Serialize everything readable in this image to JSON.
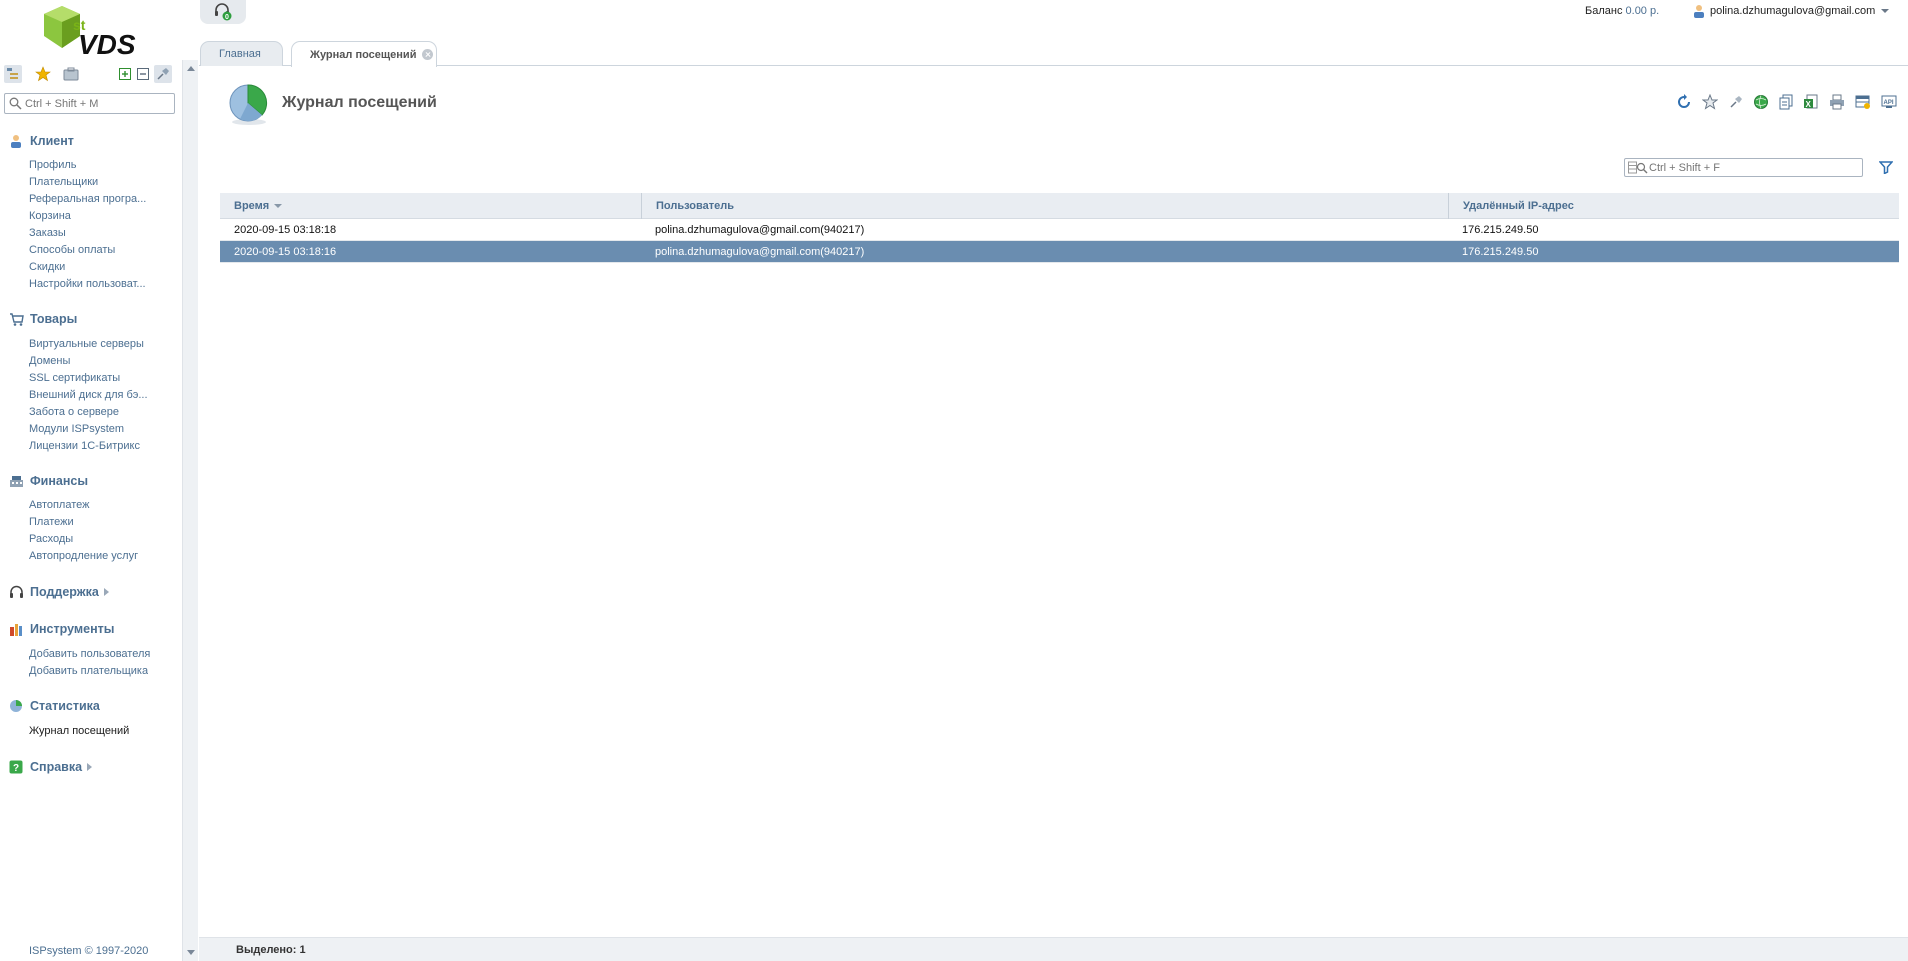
{
  "brand": {
    "logo_text": "VDS",
    "logo_sup": "st"
  },
  "header": {
    "notifications_count": "0",
    "balance_label": "Баланс",
    "balance_amount": "0.00 р.",
    "user_email": "polina.dzhumagulova@gmail.com"
  },
  "sidebar": {
    "search_placeholder": "Ctrl + Shift + M",
    "groups": [
      {
        "title": "Клиент",
        "icon": "client-icon",
        "items": [
          "Профиль",
          "Плательщики",
          "Реферальная програ...",
          "Корзина",
          "Заказы",
          "Способы оплаты",
          "Скидки",
          "Настройки пользоват..."
        ]
      },
      {
        "title": "Товары",
        "icon": "cart-icon",
        "items": [
          "Виртуальные серверы",
          "Домены",
          "SSL сертификаты",
          "Внешний диск для бэ...",
          "Забота о сервере",
          "Модули ISPsystem",
          "Лицензии 1С-Битрикс"
        ]
      },
      {
        "title": "Финансы",
        "icon": "finance-icon",
        "items": [
          "Автоплатеж",
          "Платежи",
          "Расходы",
          "Автопродление услуг"
        ]
      },
      {
        "title": "Поддержка",
        "icon": "headset-icon",
        "items": []
      },
      {
        "title": "Инструменты",
        "icon": "tools-icon",
        "items": [
          "Добавить пользователя",
          "Добавить плательщика"
        ]
      },
      {
        "title": "Статистика",
        "icon": "statistics-icon",
        "items": [
          "Журнал посещений"
        ]
      },
      {
        "title": "Справка",
        "icon": "help-icon",
        "items": []
      }
    ],
    "copyright": "ISPsystem © 1997-2020"
  },
  "tabs": [
    {
      "label": "Главная"
    },
    {
      "label": "Журнал посещений"
    }
  ],
  "page": {
    "title": "Журнал посещений",
    "filter_placeholder": "Ctrl + Shift + F"
  },
  "table": {
    "columns": [
      "Время",
      "Пользователь",
      "Удалённый IP-адрес"
    ],
    "rows": [
      [
        "2020-09-15 03:18:18",
        "polina.dzhumagulova@gmail.com(940217)",
        "176.215.249.50"
      ],
      [
        "2020-09-15 03:18:16",
        "polina.dzhumagulova@gmail.com(940217)",
        "176.215.249.50"
      ]
    ]
  },
  "status": {
    "selected_label": "Выделено: 1"
  },
  "colors": {
    "accent": "#4c6f91",
    "selected_row": "#6a8db0",
    "logo_green": "#7ab317"
  }
}
